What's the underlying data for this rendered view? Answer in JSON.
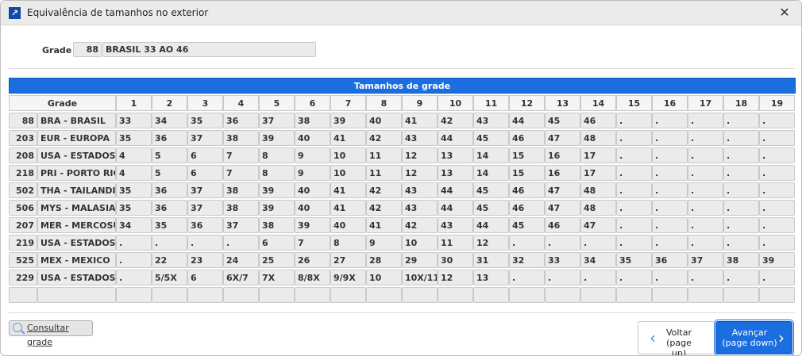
{
  "window": {
    "title": "Equivalência de tamanhos no exterior",
    "icon": "arrow-up-right-icon",
    "close": "✕"
  },
  "grade": {
    "label": "Grade",
    "code": "88",
    "name": "BRASIL 33 AO 46"
  },
  "table": {
    "title": "Tamanhos de grade",
    "grade_header": "Grade",
    "size_headers": [
      "1",
      "2",
      "3",
      "4",
      "5",
      "6",
      "7",
      "8",
      "9",
      "10",
      "11",
      "12",
      "13",
      "14",
      "15",
      "16",
      "17",
      "18",
      "19"
    ],
    "rows": [
      {
        "code": "88",
        "name": "BRA - BRASIL",
        "sizes": [
          "33",
          "34",
          "35",
          "36",
          "37",
          "38",
          "39",
          "40",
          "41",
          "42",
          "43",
          "44",
          "45",
          "46",
          ".",
          ".",
          ".",
          ".",
          "."
        ]
      },
      {
        "code": "203",
        "name": "EUR - EUROPA",
        "sizes": [
          "35",
          "36",
          "37",
          "38",
          "39",
          "40",
          "41",
          "42",
          "43",
          "44",
          "45",
          "46",
          "47",
          "48",
          ".",
          ".",
          ".",
          ".",
          "."
        ]
      },
      {
        "code": "208",
        "name": "USA - ESTADOS U",
        "sizes": [
          "4",
          "5",
          "6",
          "7",
          "8",
          "9",
          "10",
          "11",
          "12",
          "13",
          "14",
          "15",
          "16",
          "17",
          ".",
          ".",
          ".",
          ".",
          "."
        ]
      },
      {
        "code": "218",
        "name": "PRI - PORTO RIC",
        "sizes": [
          "4",
          "5",
          "6",
          "7",
          "8",
          "9",
          "10",
          "11",
          "12",
          "13",
          "14",
          "15",
          "16",
          "17",
          ".",
          ".",
          ".",
          ".",
          "."
        ]
      },
      {
        "code": "502",
        "name": "THA - TAILANDIA",
        "sizes": [
          "35",
          "36",
          "37",
          "38",
          "39",
          "40",
          "41",
          "42",
          "43",
          "44",
          "45",
          "46",
          "47",
          "48",
          ".",
          ".",
          ".",
          ".",
          "."
        ]
      },
      {
        "code": "506",
        "name": "MYS - MALASIA",
        "sizes": [
          "35",
          "36",
          "37",
          "38",
          "39",
          "40",
          "41",
          "42",
          "43",
          "44",
          "45",
          "46",
          "47",
          "48",
          ".",
          ".",
          ".",
          ".",
          "."
        ]
      },
      {
        "code": "207",
        "name": "MER - MERCOSUL",
        "sizes": [
          "34",
          "35",
          "36",
          "37",
          "38",
          "39",
          "40",
          "41",
          "42",
          "43",
          "44",
          "45",
          "46",
          "47",
          ".",
          ".",
          ".",
          ".",
          "."
        ]
      },
      {
        "code": "219",
        "name": "USA - ESTADOS U",
        "sizes": [
          ".",
          ".",
          ".",
          ".",
          "6",
          "7",
          "8",
          "9",
          "10",
          "11",
          "12",
          ".",
          ".",
          ".",
          ".",
          ".",
          ".",
          ".",
          "."
        ]
      },
      {
        "code": "525",
        "name": "MEX - MEXICO",
        "sizes": [
          ".",
          "22",
          "23",
          "24",
          "25",
          "26",
          "27",
          "28",
          "29",
          "30",
          "31",
          "32",
          "33",
          "34",
          "35",
          "36",
          "37",
          "38",
          "39"
        ]
      },
      {
        "code": "229",
        "name": "USA - ESTADOS U",
        "sizes": [
          ".",
          "5/5X",
          "6",
          "6X/7",
          "7X",
          "8/8X",
          "9/9X",
          "10",
          "10X/11",
          "12",
          "13",
          ".",
          ".",
          ".",
          ".",
          ".",
          ".",
          ".",
          "."
        ]
      },
      {
        "code": "",
        "name": "",
        "sizes": [
          "",
          "",
          "",
          "",
          "",
          "",
          "",
          "",
          "",
          "",
          "",
          "",
          "",
          "",
          "",
          "",
          "",
          "",
          ""
        ]
      }
    ]
  },
  "footer": {
    "consult": "Consultar grade",
    "back": {
      "line1": "Voltar",
      "line2": "(page up)"
    },
    "forward": {
      "line1": "Avançar",
      "line2": "(page down)"
    }
  },
  "colors": {
    "accent": "#1b6ee0",
    "cell": "#ebebeb"
  }
}
